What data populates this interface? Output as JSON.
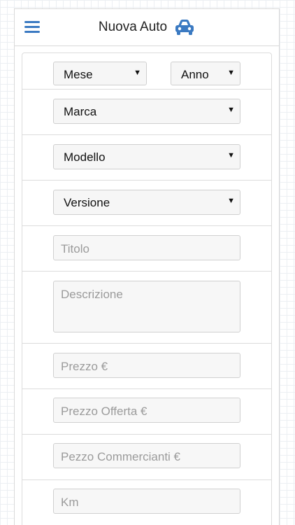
{
  "header": {
    "title": "Nuova Auto"
  },
  "form": {
    "mese": "Mese",
    "anno": "Anno",
    "marca": "Marca",
    "modello": "Modello",
    "versione": "Versione",
    "titolo_placeholder": "Titolo",
    "descrizione_placeholder": "Descrizione",
    "prezzo_placeholder": "Prezzo €",
    "prezzo_offerta_placeholder": "Prezzo Offerta €",
    "prezzo_commercianti_placeholder": "Pezzo Commercianti €",
    "km_placeholder": "Km"
  },
  "icons": {
    "menu": "hamburger-menu-icon",
    "car": "car-icon"
  },
  "colors": {
    "accent": "#3b7ac2",
    "grid": "#eceff3",
    "border": "#d9d9d9"
  }
}
